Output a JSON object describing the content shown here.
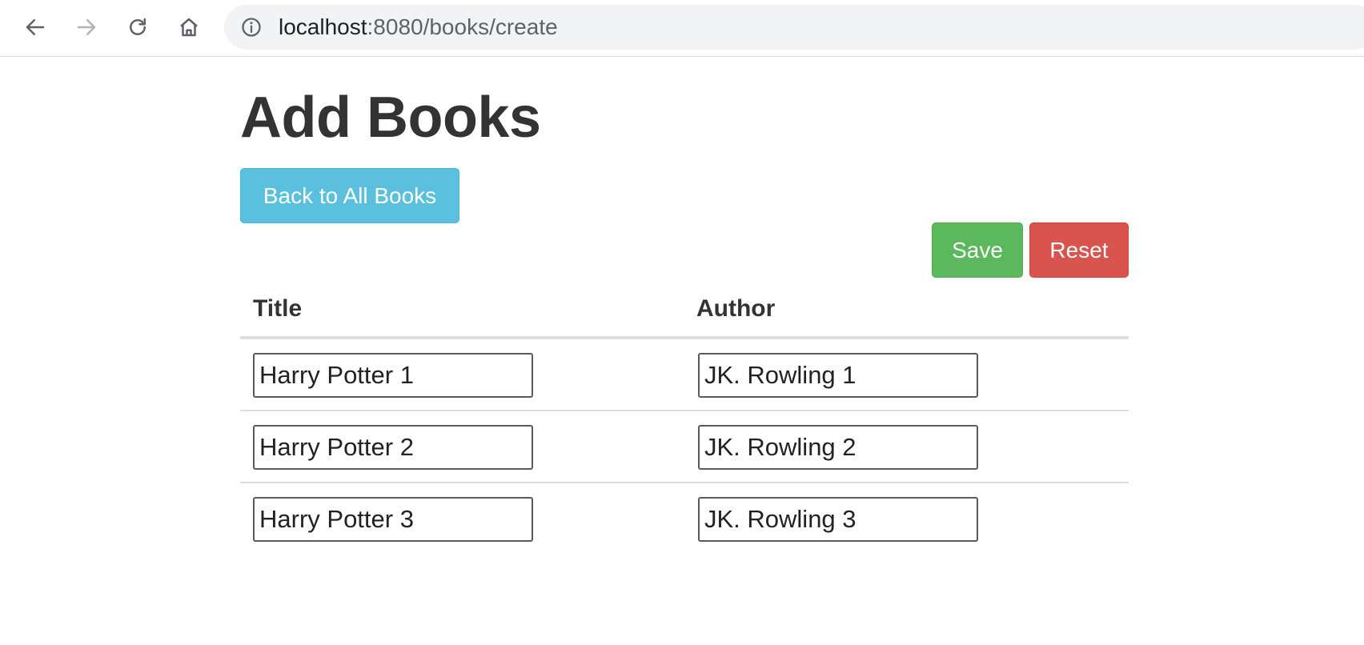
{
  "browser": {
    "url_host": "localhost",
    "url_path": ":8080/books/create"
  },
  "page": {
    "title": "Add Books",
    "back_button": "Back to All Books",
    "save_button": "Save",
    "reset_button": "Reset"
  },
  "table": {
    "headers": {
      "title": "Title",
      "author": "Author"
    },
    "rows": [
      {
        "title": "Harry Potter 1",
        "author": "JK. Rowling 1"
      },
      {
        "title": "Harry Potter 2",
        "author": "JK. Rowling 2"
      },
      {
        "title": "Harry Potter 3",
        "author": "JK. Rowling 3"
      }
    ]
  },
  "colors": {
    "info": "#5bc0de",
    "success": "#5cb85c",
    "danger": "#d9534f"
  }
}
